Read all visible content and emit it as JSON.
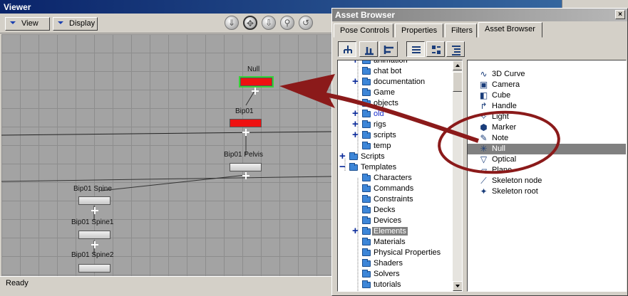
{
  "viewer": {
    "title": "Viewer",
    "view_menu": "View",
    "display_menu": "Display",
    "status": "Ready",
    "nodes": [
      {
        "name": "Null",
        "style": "red",
        "selected": true
      },
      {
        "name": "Bip01",
        "style": "red",
        "selected": false
      },
      {
        "name": "Bip01 Pelvis",
        "style": "grey",
        "selected": false
      },
      {
        "name": "Bip01 Spine",
        "style": "grey",
        "selected": false
      },
      {
        "name": "Bip01 Spine1",
        "style": "grey",
        "selected": false
      },
      {
        "name": "Bip01 Spine2",
        "style": "grey",
        "selected": false
      }
    ]
  },
  "asset_browser": {
    "title": "Asset Browser",
    "close_label": "×",
    "tabs": [
      "Pose Controls",
      "Properties",
      "Filters",
      "Asset Browser"
    ],
    "active_tab": "Asset Browser",
    "tree": [
      {
        "label": "animation",
        "level": 1,
        "expander": "plus"
      },
      {
        "label": "chat bot",
        "level": 1,
        "expander": ""
      },
      {
        "label": "documentation",
        "level": 1,
        "expander": "plus"
      },
      {
        "label": "Game",
        "level": 1,
        "expander": ""
      },
      {
        "label": "objects",
        "level": 1,
        "expander": ""
      },
      {
        "label": "old",
        "level": 1,
        "expander": "plus",
        "color": "blue"
      },
      {
        "label": "rigs",
        "level": 1,
        "expander": "plus"
      },
      {
        "label": "scripts",
        "level": 1,
        "expander": "plus"
      },
      {
        "label": "temp",
        "level": 1,
        "expander": ""
      },
      {
        "label": "Scripts",
        "level": 0,
        "expander": "plus"
      },
      {
        "label": "Templates",
        "level": 0,
        "expander": "minus"
      },
      {
        "label": "Characters",
        "level": 1,
        "expander": ""
      },
      {
        "label": "Commands",
        "level": 1,
        "expander": ""
      },
      {
        "label": "Constraints",
        "level": 1,
        "expander": ""
      },
      {
        "label": "Decks",
        "level": 1,
        "expander": ""
      },
      {
        "label": "Devices",
        "level": 1,
        "expander": ""
      },
      {
        "label": "Elements",
        "level": 1,
        "expander": "plus",
        "selected": true
      },
      {
        "label": "Materials",
        "level": 1,
        "expander": ""
      },
      {
        "label": "Physical Properties",
        "level": 1,
        "expander": ""
      },
      {
        "label": "Shaders",
        "level": 1,
        "expander": ""
      },
      {
        "label": "Solvers",
        "level": 1,
        "expander": ""
      },
      {
        "label": "tutorials",
        "level": 1,
        "expander": ""
      }
    ],
    "assets": [
      {
        "label": "3D Curve",
        "icon": "curve-icon",
        "glyph": "∿"
      },
      {
        "label": "Camera",
        "icon": "camera-icon",
        "glyph": "▣"
      },
      {
        "label": "Cube",
        "icon": "cube-icon",
        "glyph": "◧"
      },
      {
        "label": "Handle",
        "icon": "handle-icon",
        "glyph": "↱"
      },
      {
        "label": "Light",
        "icon": "light-icon",
        "glyph": "✧"
      },
      {
        "label": "Marker",
        "icon": "marker-icon",
        "glyph": "⬢"
      },
      {
        "label": "Note",
        "icon": "note-icon",
        "glyph": "✎"
      },
      {
        "label": "Null",
        "icon": "null-icon",
        "glyph": "✳",
        "selected": true
      },
      {
        "label": "Optical",
        "icon": "optical-icon",
        "glyph": "▽"
      },
      {
        "label": "Plane",
        "icon": "plane-icon",
        "glyph": "▱"
      },
      {
        "label": "Skeleton node",
        "icon": "skeleton-node-icon",
        "glyph": "⟋"
      },
      {
        "label": "Skeleton root",
        "icon": "skeleton-root-icon",
        "glyph": "✦"
      }
    ]
  },
  "colors": {
    "annotation": "#8b1a1a",
    "selection": "#808080",
    "node_red": "#ee1111",
    "node_selected_outline": "#3ad13a"
  }
}
